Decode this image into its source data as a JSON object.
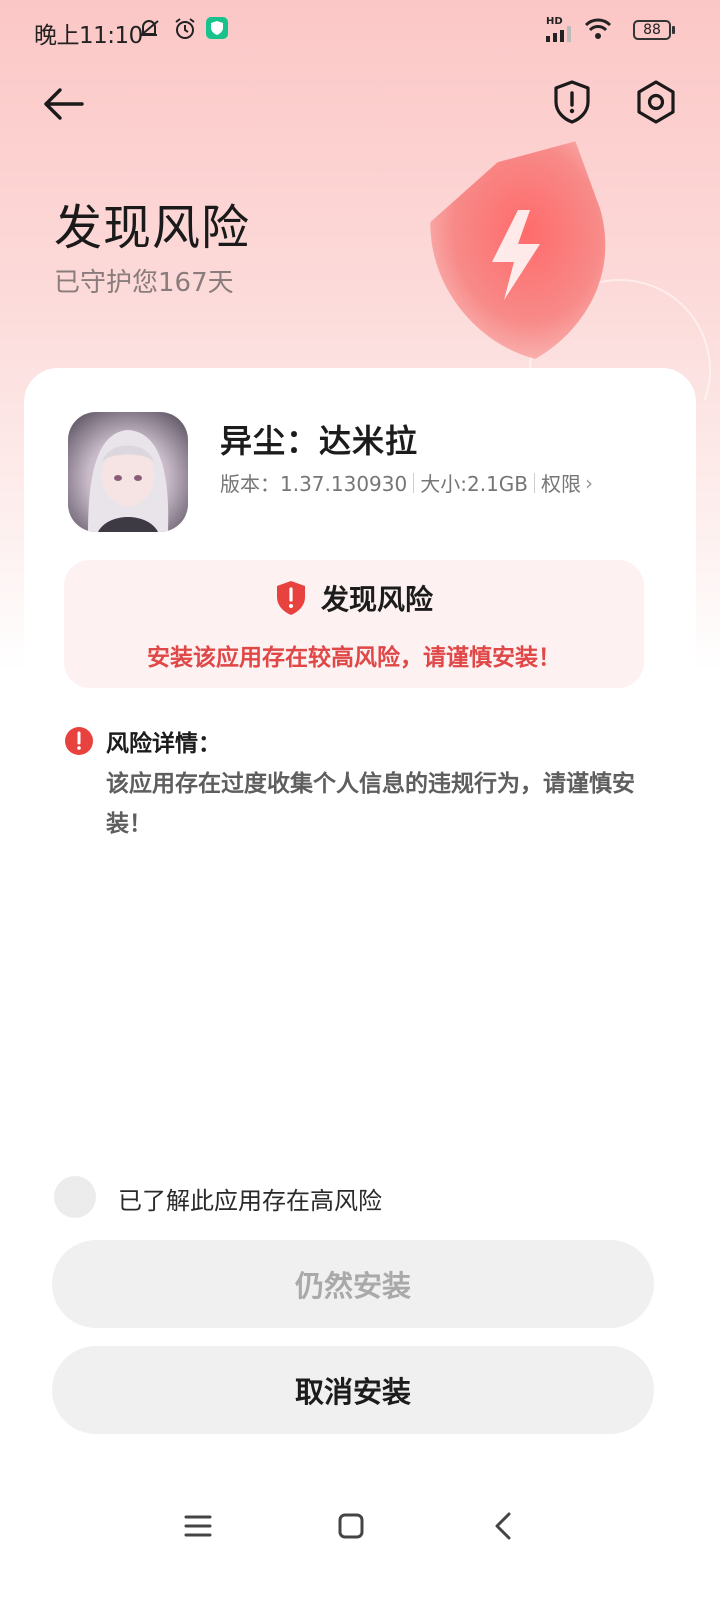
{
  "status_bar": {
    "time": "晚上11:10",
    "network": "HD",
    "battery": "88",
    "icons": [
      "mute-icon",
      "alarm-icon",
      "security-app-icon",
      "signal-icon",
      "wifi-icon",
      "battery-icon"
    ]
  },
  "header": {
    "back_icon": "back-arrow-icon",
    "shield_icon": "shield-alert-icon",
    "settings_icon": "settings-icon"
  },
  "hero": {
    "title": "发现风险",
    "subtitle": "已守护您167天"
  },
  "app": {
    "name": "异尘：达米拉",
    "version": "版本：1.37.130930",
    "size": "大小:2.1GB",
    "permissions": "权限",
    "permissions_chevron": "›"
  },
  "risk_banner": {
    "title": "发现风险",
    "message": "安装该应用存在较高风险，请谨慎安装！"
  },
  "risk_detail": {
    "title": "风险详情：",
    "text": "该应用存在过度收集个人信息的违规行为，请谨慎安装！"
  },
  "acknowledge": {
    "label": "已了解此应用存在高风险"
  },
  "buttons": {
    "install_anyway": "仍然安装",
    "cancel_install": "取消安装"
  },
  "colors": {
    "accent_red": "#e04747",
    "shield_red": "#e8423f",
    "disabled_text": "#a9a9a9"
  }
}
